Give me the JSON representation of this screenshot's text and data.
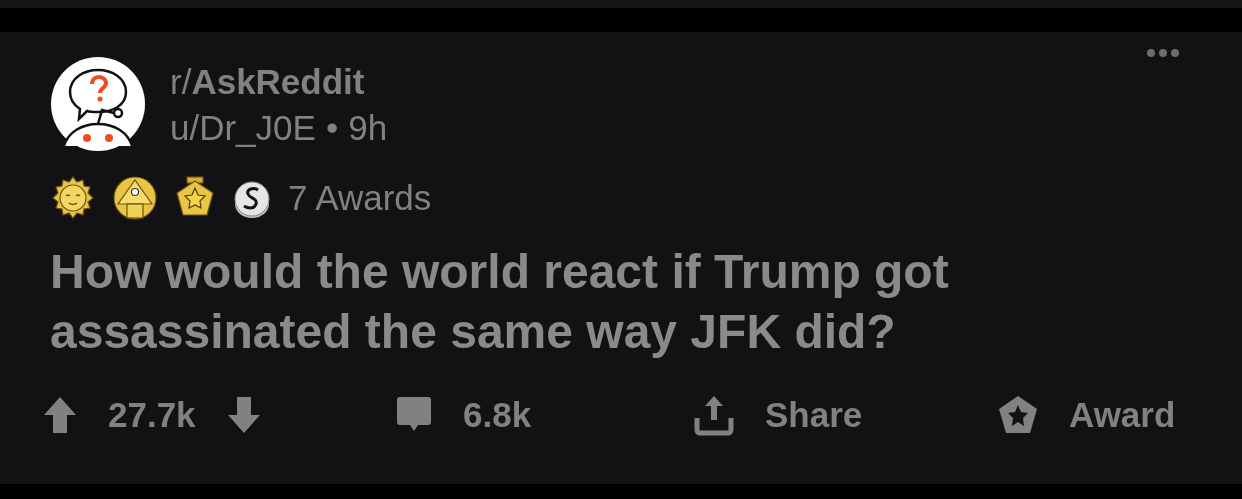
{
  "post": {
    "subreddit": "r/**AskReddit**",
    "author": "u/Dr_J0E",
    "separator": "•",
    "age": "9h",
    "awards_label": "7 Awards",
    "title": "How would the world react if Trump got assassinated the same way JFK did?"
  },
  "actions": [
    {
      "kind": "vote",
      "label": "27.7k"
    },
    {
      "kind": "comment",
      "label": "6.8k"
    },
    {
      "kind": "share",
      "label": "Share"
    },
    {
      "kind": "award",
      "label": "Award"
    }
  ]
}
